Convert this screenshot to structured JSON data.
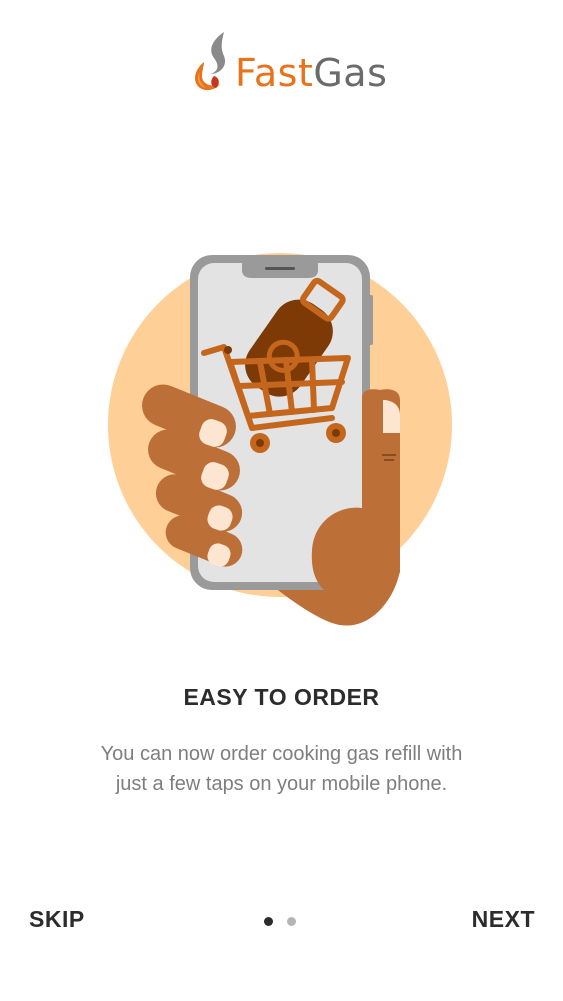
{
  "brand": {
    "name_part1": "Fast",
    "name_part2": "Gas",
    "color_primary": "#e8731e",
    "color_secondary": "#6b6b6b"
  },
  "illustration": {
    "icon": "hand-holding-phone-with-gas-cylinder-cart-icon",
    "circle_color": "#fecf97",
    "hand_color": "#bd6f38",
    "cart_color": "#c4671d"
  },
  "onboarding": {
    "title": "EASY TO ORDER",
    "description": "You can now order cooking gas refill with just a few taps on your mobile phone.",
    "page_indicator": {
      "current": 1,
      "total": 2
    }
  },
  "footer": {
    "skip_label": "SKIP",
    "next_label": "NEXT"
  }
}
